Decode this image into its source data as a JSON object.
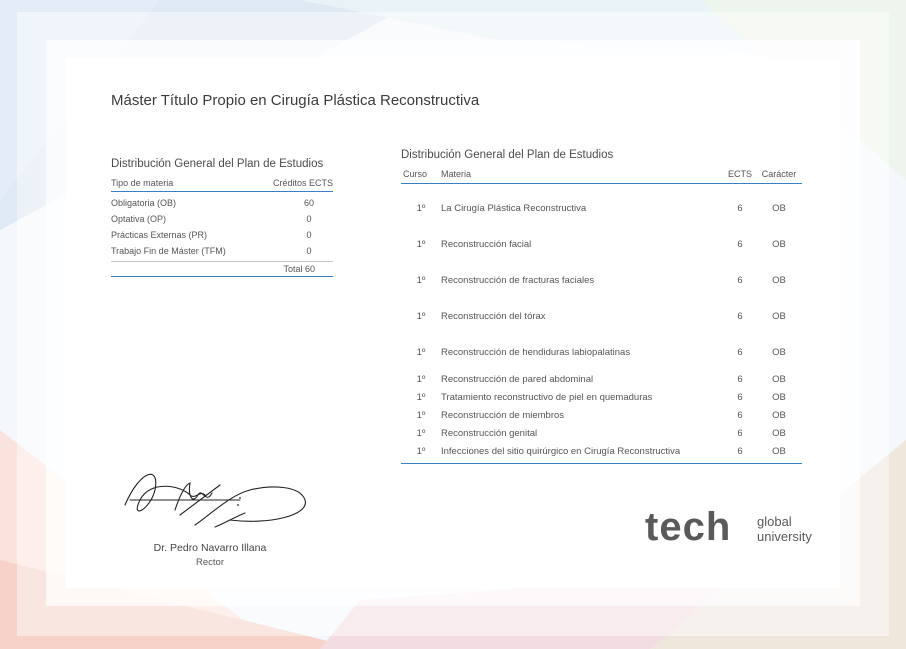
{
  "document": {
    "title": "Máster Título Propio en Cirugía Plástica Reconstructiva"
  },
  "summary": {
    "heading": "Distribución General del Plan de Estudios",
    "col_type": "Tipo de materia",
    "col_credits": "Créditos ECTS",
    "rows": [
      {
        "type": "Obligatoria (OB)",
        "credits": "60"
      },
      {
        "type": "Optativa (OP)",
        "credits": "0"
      },
      {
        "type": "Prácticas Externas (PR)",
        "credits": "0"
      },
      {
        "type": "Trabajo Fin de Máster (TFM)",
        "credits": "0"
      }
    ],
    "total": "Total 60"
  },
  "plan": {
    "heading": "Distribución General del Plan de Estudios",
    "columns": {
      "curso": "Curso",
      "materia": "Materia",
      "ects": "ECTS",
      "caracter": "Carácter"
    },
    "rows": [
      {
        "curso": "1º",
        "materia": "La Cirugía Plástica Reconstructiva",
        "ects": "6",
        "caracter": "OB"
      },
      {
        "curso": "1º",
        "materia": "Reconstrucción facial",
        "ects": "6",
        "caracter": "OB"
      },
      {
        "curso": "1º",
        "materia": "Reconstrucción de fracturas faciales",
        "ects": "6",
        "caracter": "OB"
      },
      {
        "curso": "1º",
        "materia": "Reconstrucción del tórax",
        "ects": "6",
        "caracter": "OB"
      },
      {
        "curso": "1º",
        "materia": "Reconstrucción de hendiduras labiopalatinas",
        "ects": "6",
        "caracter": "OB"
      },
      {
        "curso": "1º",
        "materia": "Reconstrucción de pared abdominal",
        "ects": "6",
        "caracter": "OB"
      },
      {
        "curso": "1º",
        "materia": "Tratamiento reconstructivo de piel en quemaduras",
        "ects": "6",
        "caracter": "OB"
      },
      {
        "curso": "1º",
        "materia": "Reconstrucción de miembros",
        "ects": "6",
        "caracter": "OB"
      },
      {
        "curso": "1º",
        "materia": "Reconstrucción genital",
        "ects": "6",
        "caracter": "OB"
      },
      {
        "curso": "1º",
        "materia": "Infecciones del sitio quirúrgico en Cirugía Reconstructiva",
        "ects": "6",
        "caracter": "OB"
      }
    ]
  },
  "signer": {
    "name": "Dr. Pedro Navarro Illana",
    "role": "Rector"
  },
  "logo": {
    "wordmark": "tech",
    "line1": "global",
    "line2": "university"
  },
  "colors": {
    "accent_blue": "#3a7fc1",
    "logo_teal": "#2bb3a6",
    "logo_gray": "#5a5a5a"
  }
}
